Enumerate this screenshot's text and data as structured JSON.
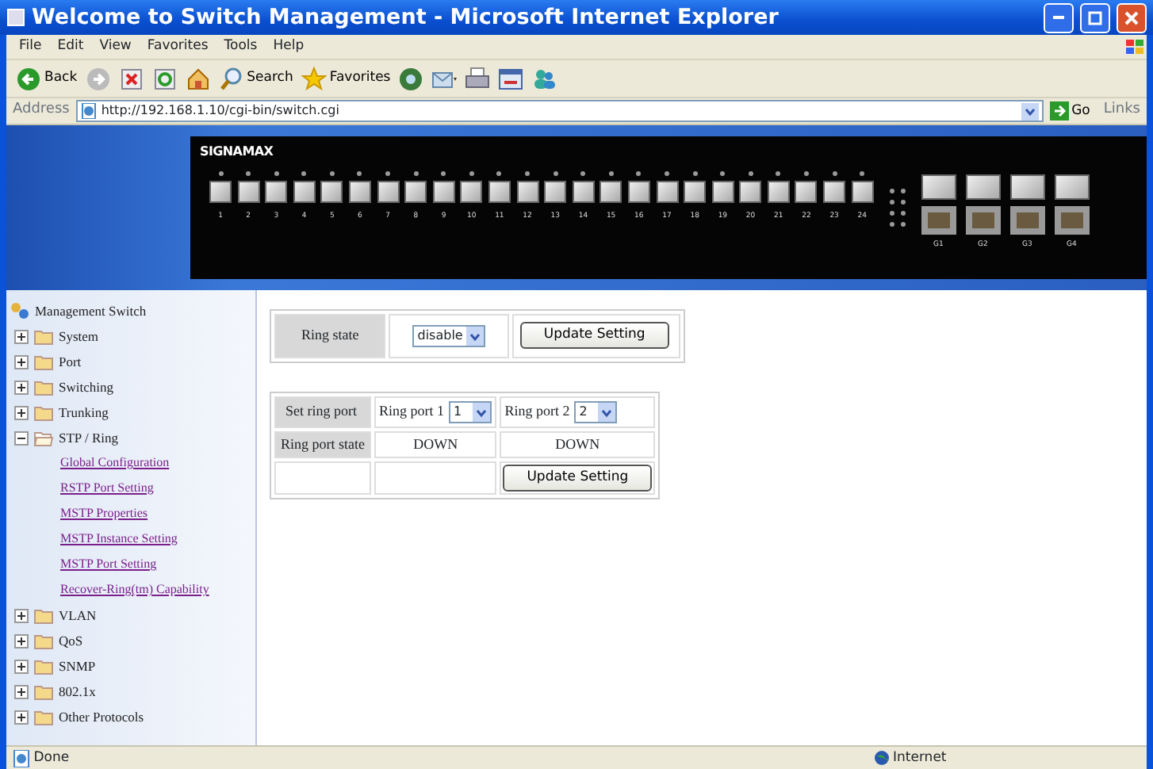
{
  "window": {
    "title": "Welcome to Switch Management - Microsoft Internet Explorer"
  },
  "menu": [
    "File",
    "Edit",
    "View",
    "Favorites",
    "Tools",
    "Help"
  ],
  "toolbar": [
    {
      "kind": "back",
      "label": "Back"
    },
    {
      "kind": "forward"
    },
    {
      "kind": "stop"
    },
    {
      "kind": "refresh"
    },
    {
      "kind": "home"
    },
    {
      "kind": "search",
      "label": "Search"
    },
    {
      "kind": "favorites",
      "label": "Favorites"
    },
    {
      "kind": "media"
    },
    {
      "kind": "mail"
    },
    {
      "kind": "print"
    },
    {
      "kind": "edit"
    },
    {
      "kind": "messenger"
    }
  ],
  "address": {
    "label": "Address",
    "value": "http://192.168.1.10/cgi-bin/switch.cgi",
    "go": "Go",
    "links": "Links"
  },
  "device": {
    "logo": "SIGNAMAX",
    "ports": [
      "1",
      "2",
      "3",
      "4",
      "5",
      "6",
      "7",
      "8",
      "9",
      "10",
      "11",
      "12",
      "13",
      "14",
      "15",
      "16",
      "17",
      "18",
      "19",
      "20",
      "21",
      "22",
      "23",
      "24"
    ],
    "uplinks": [
      "G1",
      "G2",
      "G3",
      "G4"
    ]
  },
  "sidebar": {
    "root": "Management Switch",
    "items": [
      {
        "label": "System",
        "expanded": false
      },
      {
        "label": "Port",
        "expanded": false
      },
      {
        "label": "Switching",
        "expanded": false
      },
      {
        "label": "Trunking",
        "expanded": false
      },
      {
        "label": "STP / Ring",
        "expanded": true,
        "children": [
          {
            "label": "Global Configuration"
          },
          {
            "label": "RSTP Port Setting"
          },
          {
            "label": "MSTP Properties"
          },
          {
            "label": "MSTP Instance Setting"
          },
          {
            "label": "MSTP Port Setting"
          },
          {
            "label": "Recover-Ring(tm) Capability"
          }
        ]
      },
      {
        "label": "VLAN",
        "expanded": false
      },
      {
        "label": "QoS",
        "expanded": false
      },
      {
        "label": "SNMP",
        "expanded": false
      },
      {
        "label": "802.1x",
        "expanded": false
      },
      {
        "label": "Other Protocols",
        "expanded": false
      }
    ]
  },
  "ring_state": {
    "label": "Ring state",
    "value": "disable",
    "button": "Update Setting"
  },
  "ring_ports": {
    "label": "Set ring port",
    "port_1": {
      "label": "Ring port 1",
      "value": "1"
    },
    "port_2": {
      "label": "Ring port 2",
      "value": "2"
    },
    "state_label": "Ring port state",
    "state_1": "DOWN",
    "state_2": "DOWN",
    "button": "Update Setting"
  },
  "status_bar": {
    "text": "Done",
    "zone": "Internet"
  }
}
